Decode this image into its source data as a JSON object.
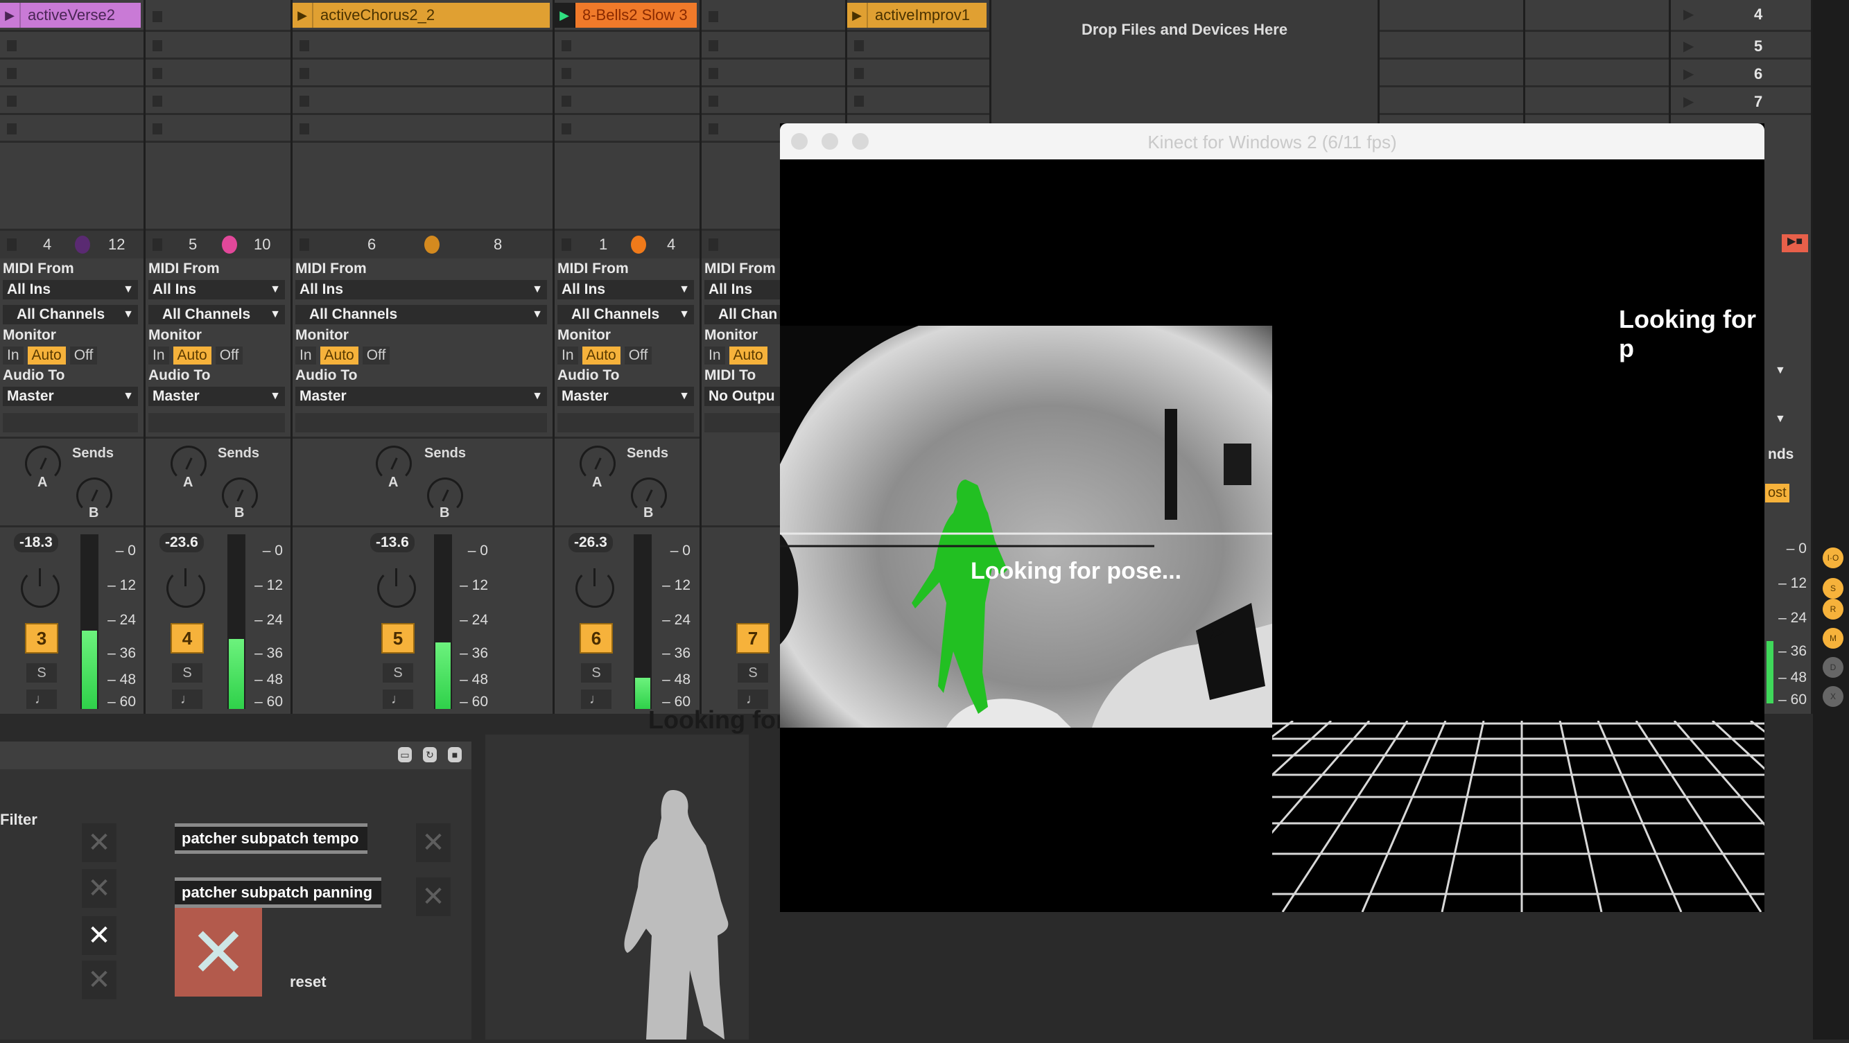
{
  "session": {
    "tracks": [
      {
        "clip": "activeVerse2",
        "clip_color": "#c97ad6",
        "clip_text_color": "#4a2555",
        "playing": false,
        "header": {
          "left": "4",
          "right": "12",
          "dot_color": "#5a2a72"
        },
        "io": {
          "input_label": "MIDI From",
          "input": "All Ins",
          "channel": "All Channels",
          "monitor_label": "Monitor",
          "monitor": [
            "In",
            "Auto",
            "Off"
          ],
          "monitor_active": "Auto",
          "output_label": "Audio To",
          "output": "Master"
        },
        "sends_label": "Sends",
        "send_a": "A",
        "send_b": "B",
        "volume": "-18.3",
        "track_number": "3",
        "solo": "S",
        "arm": "♩",
        "meter_level": 0.45
      },
      {
        "clip": "",
        "clip_color": "",
        "playing": false,
        "header": {
          "left": "5",
          "right": "10",
          "dot_color": "#e2489a"
        },
        "io": {
          "input_label": "MIDI From",
          "input": "All Ins",
          "channel": "All Channels",
          "monitor_label": "Monitor",
          "monitor": [
            "In",
            "Auto",
            "Off"
          ],
          "monitor_active": "Auto",
          "output_label": "Audio To",
          "output": "Master"
        },
        "sends_label": "Sends",
        "send_a": "A",
        "send_b": "B",
        "volume": "-23.6",
        "track_number": "4",
        "solo": "S",
        "arm": "♩",
        "meter_level": 0.4
      },
      {
        "clip": "activeChorus2_2",
        "clip_color": "#e0a032",
        "clip_text_color": "#4a3200",
        "playing": false,
        "header": {
          "left": "6",
          "right": "8",
          "dot_color": "#d48a1f"
        },
        "io": {
          "input_label": "MIDI From",
          "input": "All Ins",
          "channel": "All Channels",
          "monitor_label": "Monitor",
          "monitor": [
            "In",
            "Auto",
            "Off"
          ],
          "monitor_active": "Auto",
          "output_label": "Audio To",
          "output": "Master"
        },
        "sends_label": "Sends",
        "send_a": "A",
        "send_b": "B",
        "volume": "-13.6",
        "track_number": "5",
        "solo": "S",
        "arm": "♩",
        "meter_level": 0.38
      },
      {
        "clip": "8-Bells2 Slow 3",
        "clip_color": "#f07a2a",
        "clip_text_color": "#8a2a00",
        "playing": true,
        "header": {
          "left": "1",
          "right": "4",
          "dot_color": "#f07a1a"
        },
        "io": {
          "input_label": "MIDI From",
          "input": "All Ins",
          "channel": "All Channels",
          "monitor_label": "Monitor",
          "monitor": [
            "In",
            "Auto",
            "Off"
          ],
          "monitor_active": "Auto",
          "output_label": "Audio To",
          "output": "Master"
        },
        "sends_label": "Sends",
        "send_a": "A",
        "send_b": "B",
        "volume": "-26.3",
        "track_number": "6",
        "solo": "S",
        "arm": "♩",
        "meter_level": 0.18
      },
      {
        "clip": "",
        "clip_color": "",
        "playing": false,
        "header": {
          "left": "",
          "right": "",
          "dot_color": ""
        },
        "io": {
          "input_label": "MIDI From",
          "input": "All Ins",
          "channel": "All Chan",
          "monitor_label": "Monitor",
          "monitor": [
            "In",
            "Auto"
          ],
          "monitor_active": "Auto",
          "output_label": "MIDI To",
          "output": "No Outpu"
        },
        "sends_label": "",
        "send_a": "",
        "send_b": "",
        "volume": "",
        "track_number": "7",
        "solo": "S",
        "arm": "♩",
        "meter_level": 0
      },
      {
        "clip": "activeImprov1",
        "clip_color": "#e0a032",
        "clip_text_color": "#4a3200",
        "playing": false
      }
    ],
    "drop_zone": "Drop Files and Devices Here",
    "scenes": [
      "4",
      "5",
      "6",
      "7"
    ],
    "meter_scale": [
      "0",
      "12",
      "24",
      "36",
      "48",
      "60"
    ],
    "master": {
      "sends_label": "nds",
      "post_label": "ost",
      "side_buttons": [
        "I·O",
        "S",
        "R",
        "M",
        "D",
        "X"
      ]
    }
  },
  "kinect": {
    "title": "Kinect for Windows 2 (6/11 fps)",
    "status": "Looking for pose...",
    "status_clipped": "Looking for p",
    "status_echo": "Looking for pose..."
  },
  "max_patch": {
    "filter_label": "Filter",
    "messages": [
      "patcher subpatch tempo",
      "patcher subpatch panning"
    ],
    "reset_label": "reset",
    "toggle_states": [
      false,
      false,
      true,
      false
    ],
    "header_icons": [
      "presentation-icon",
      "refresh-icon",
      "lock-icon"
    ]
  },
  "colors": {
    "accent": "#f6b23b",
    "meter_green": "#3fd85a",
    "reset_red": "#b35a4c",
    "skeleton_green": "#22c022"
  }
}
